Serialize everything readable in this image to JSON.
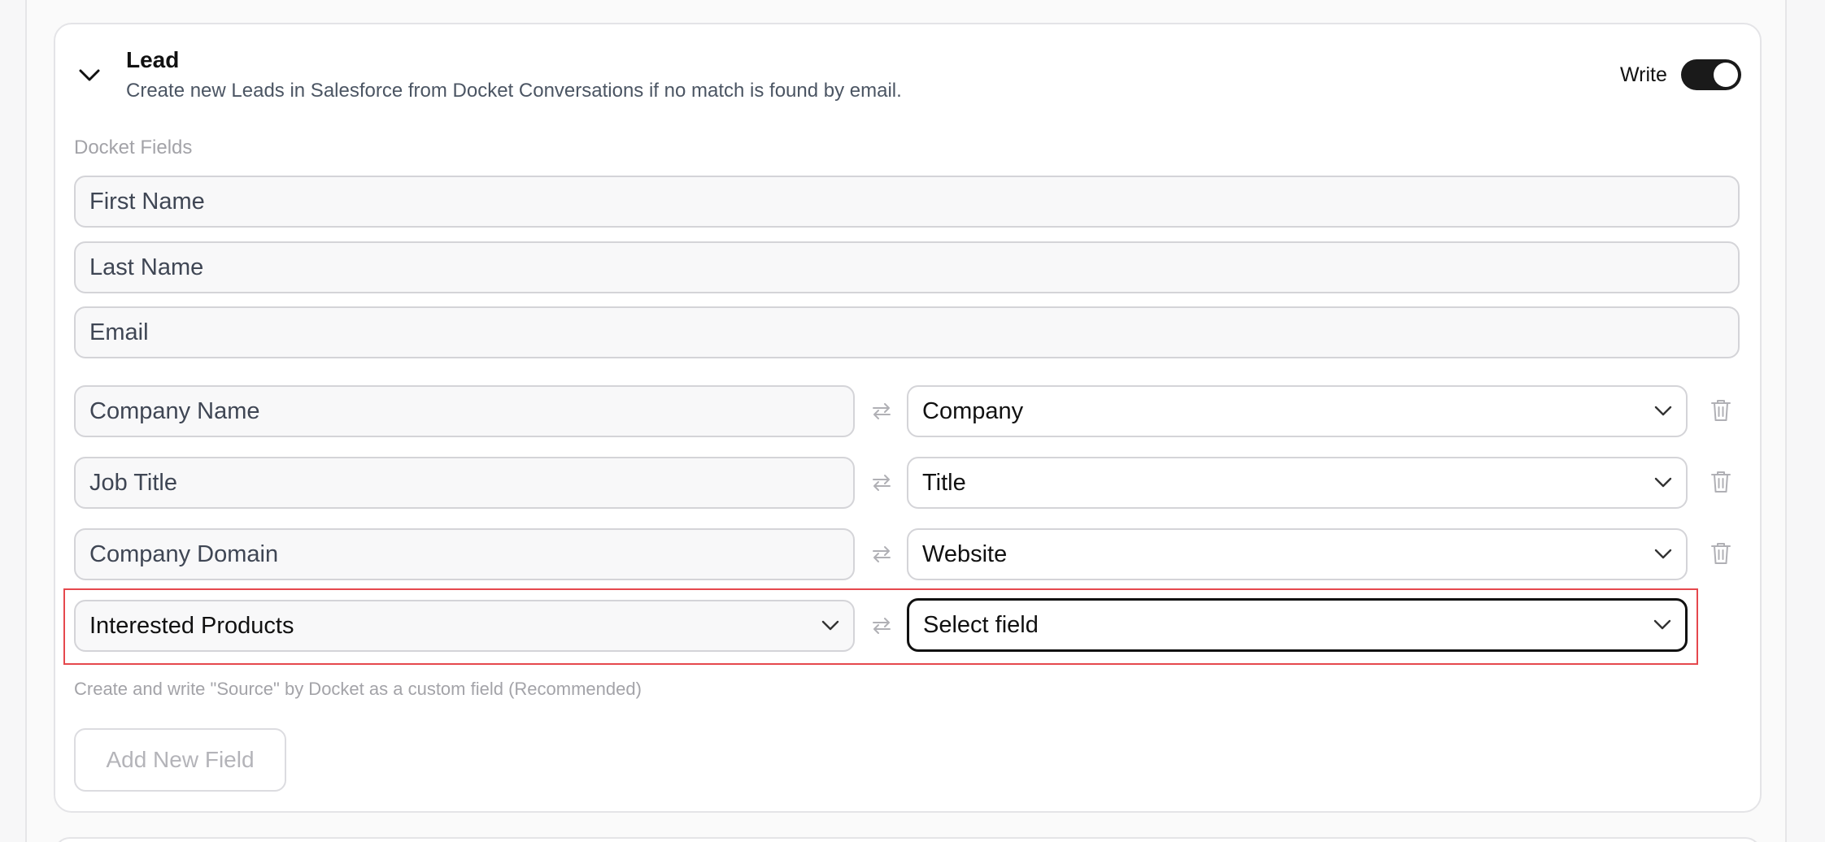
{
  "lead": {
    "title": "Lead",
    "subtitle": "Create new Leads in Salesforce from Docket Conversations if no match is found by email.",
    "write_label": "Write",
    "write_enabled": true
  },
  "docket_fields_label": "Docket Fields",
  "fixed_fields": [
    "First Name",
    "Last Name",
    "Email"
  ],
  "mappings": [
    {
      "docket": "Company Name",
      "salesforce": "Company"
    },
    {
      "docket": "Job Title",
      "salesforce": "Title"
    },
    {
      "docket": "Company Domain",
      "salesforce": "Website"
    }
  ],
  "new_mapping": {
    "docket": "Interested Products",
    "salesforce_placeholder": "Select field"
  },
  "hint": "Create and write \"Source\" by Docket as a custom field (Recommended)",
  "add_button": "Add New Field",
  "icons": {
    "collapse": "chevron-down-icon",
    "swap": "swap-arrows-icon",
    "delete": "trash-icon",
    "dropdown": "chevron-down-icon"
  },
  "colors": {
    "toggle_on": "#1a1a1a",
    "highlight": "#e5484d"
  }
}
